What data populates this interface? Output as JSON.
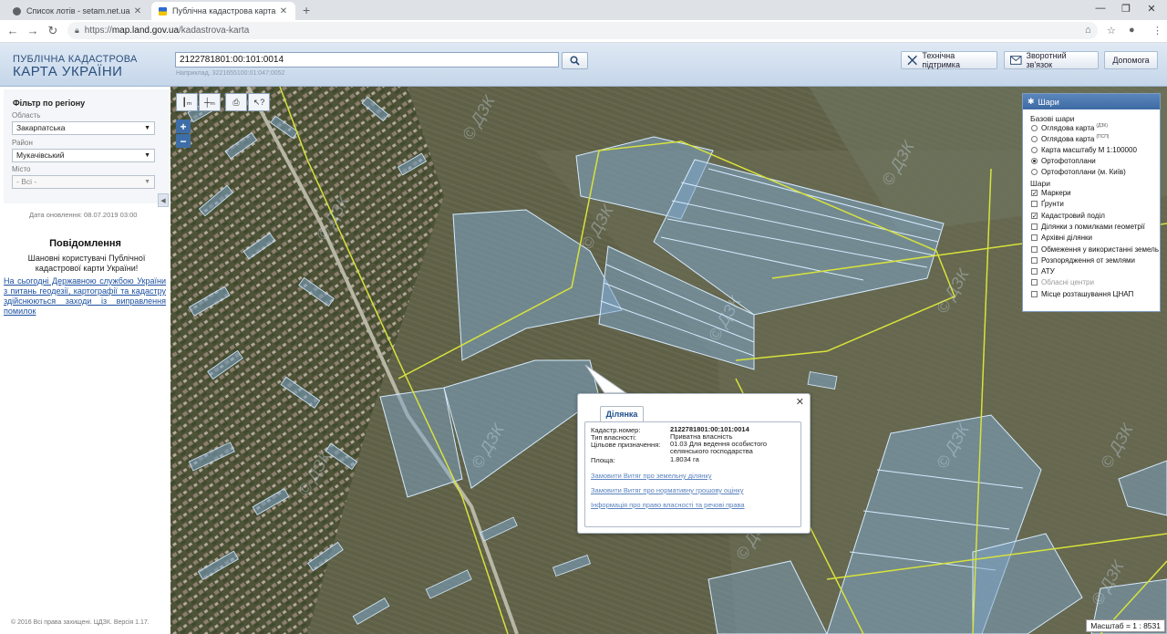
{
  "browser": {
    "tabs": [
      {
        "title": "Список лотів - setam.net.ua",
        "active": false
      },
      {
        "title": "Публічна кадастрова карта Укр...",
        "active": true
      }
    ],
    "url_protocol": "https://",
    "url_host": "map.land.gov.ua",
    "url_path": "/kadastrova-karta"
  },
  "header": {
    "brand_line1": "ПУБЛІЧНА КАДАСТРОВА",
    "brand_line2": "КАРТА УКРАЇНИ",
    "search_value": "2122781801:00:101:0014",
    "search_hint": "Наприклад, 3221655100:01:047:0052",
    "buttons": {
      "support": "Технічна підтримка",
      "feedback": "Зворотний зв'язок",
      "help": "Допомога"
    }
  },
  "sidebar": {
    "filter_title": "Фільтр по регіону",
    "oblast_label": "Область",
    "oblast_value": "Закарпатська",
    "rayon_label": "Район",
    "rayon_value": "Мукачівський",
    "city_label": "Місто",
    "city_value": "- Всі -",
    "updated": "Дата оновлення: 08.07.2019 03:00",
    "message_title": "Повідомлення",
    "message_text": "Шановні користувачі Публічної кадастрової карти України!",
    "message_link": "На сьогодні Державною службою України з питань геодезії, картографії та кадастру здійснюються заходи із виправлення помилок",
    "copyright": "© 2016 Всі права захищені. ЦДЗК. Версія 1.17."
  },
  "layers": {
    "title": "Шари",
    "base_title": "Базові шари",
    "base": [
      {
        "label": "Оглядова карта",
        "sup": "(ДЗК)",
        "checked": false
      },
      {
        "label": "Оглядова карта",
        "sup": "(ПСП)",
        "checked": false
      },
      {
        "label": "Карта масштабу М 1:100000",
        "checked": false
      },
      {
        "label": "Ортофотоплани",
        "checked": true
      },
      {
        "label": "Ортофотоплани (м. Київ)",
        "checked": false
      }
    ],
    "layers_title": "Шари",
    "items": [
      {
        "label": "Маркери",
        "checked": true,
        "dim": false
      },
      {
        "label": "Ґрунти",
        "checked": false,
        "dim": false
      },
      {
        "label": "Кадастровий поділ",
        "checked": true,
        "dim": false
      },
      {
        "label": "Ділянки з помилками геометрії",
        "checked": false,
        "dim": false
      },
      {
        "label": "Архівні ділянки",
        "checked": false,
        "dim": false
      },
      {
        "label": "Обмеження у використанні земель",
        "checked": false,
        "dim": false
      },
      {
        "label": "Розпорядження от землями",
        "checked": false,
        "dim": false
      },
      {
        "label": "АТУ",
        "checked": false,
        "dim": false
      },
      {
        "label": "Обласні центри",
        "checked": false,
        "dim": true
      },
      {
        "label": "Місце розташування ЦНАП",
        "checked": false,
        "dim": false
      }
    ]
  },
  "popup": {
    "tab": "Ділянка",
    "rows": [
      {
        "key": "Кадастр.номер:",
        "value": "2122781801:00:101:0014"
      },
      {
        "key": "Тип власності:",
        "value": "Приватна власність"
      },
      {
        "key": "Цільове призначення:",
        "value": "01.03 Для ведення особистого селянського господарства"
      },
      {
        "key": "Площа:",
        "value": "1.8034 га"
      }
    ],
    "links": [
      "Замовити Витяг про земельну ділянку",
      "Замовити Витяг про нормативну грошову оцінку",
      "Інформація про право власності та речові права"
    ]
  },
  "map": {
    "scale": "Масштаб = 1 : 8531",
    "watermark": "© ДЗК"
  }
}
